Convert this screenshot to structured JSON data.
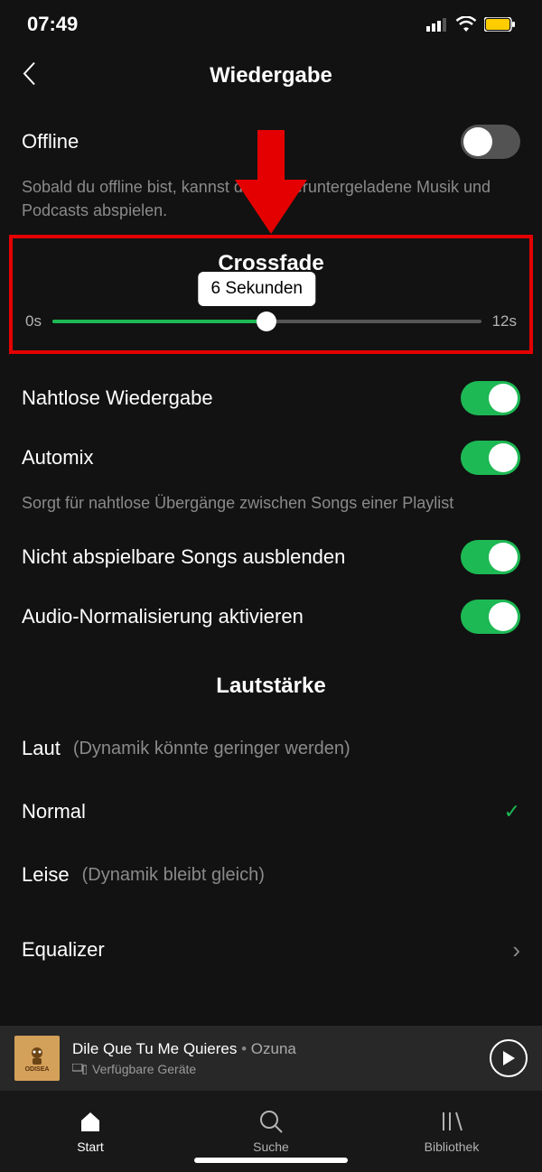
{
  "status": {
    "time": "07:49"
  },
  "header": {
    "title": "Wiedergabe"
  },
  "offline": {
    "label": "Offline",
    "desc": "Sobald du offline bist, kannst du nur heruntergeladene Musik und Podcasts abspielen."
  },
  "crossfade": {
    "title": "Crossfade",
    "min": "0s",
    "max": "12s",
    "tooltip": "6  Sekunden",
    "percent": 50
  },
  "toggles": {
    "seamless": "Nahtlose Wiedergabe",
    "automix": "Automix",
    "automix_desc": "Sorgt für nahtlose Übergänge zwischen Songs einer Playlist",
    "hide_unplayable": "Nicht abspielbare Songs ausblenden",
    "normalize": "Audio-Normalisierung aktivieren"
  },
  "volume": {
    "heading": "Lautstärke",
    "loud": "Laut",
    "loud_hint": "(Dynamik könnte geringer werden)",
    "normal": "Normal",
    "quiet": "Leise",
    "quiet_hint": "(Dynamik bleibt gleich)"
  },
  "equalizer": "Equalizer",
  "now_playing": {
    "title": "Dile Que Tu Me Quieres",
    "artist": "Ozuna",
    "devices": "Verfügbare Geräte",
    "art_label": "ODISEA"
  },
  "tabs": {
    "start": "Start",
    "search": "Suche",
    "library": "Bibliothek"
  }
}
